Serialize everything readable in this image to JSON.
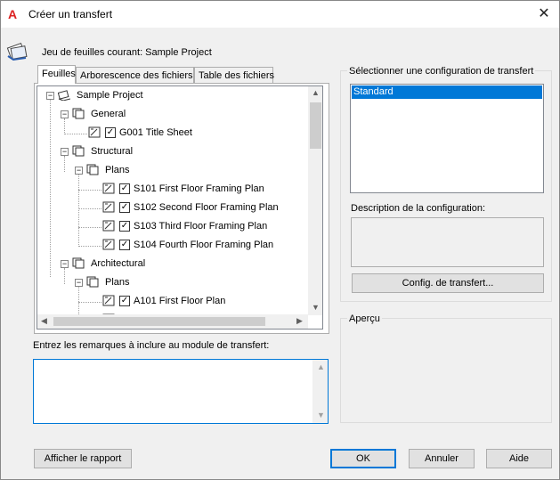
{
  "window": {
    "title": "Créer un transfert",
    "close_glyph": "✕",
    "app_icon": "A"
  },
  "header": {
    "current_sheetset": "Jeu de feuilles courant: Sample Project"
  },
  "tabs": [
    {
      "label": "Feuilles",
      "active": true
    },
    {
      "label": "Arborescence des fichiers",
      "active": false
    },
    {
      "label": "Table des fichiers",
      "active": false
    }
  ],
  "tree": {
    "root": "Sample Project",
    "general": "General",
    "g001": "G001 Title Sheet",
    "structural": "Structural",
    "plans1": "Plans",
    "s101": "S101 First Floor Framing Plan",
    "s102": "S102 Second Floor Framing Plan",
    "s103": "S103 Third Floor Framing Plan",
    "s104": "S104 Fourth Floor Framing Plan",
    "architectural": "Architectural",
    "plans2": "Plans",
    "a101": "A101 First Floor Plan"
  },
  "notes": {
    "label": "Entrez les remarques à inclure au module de transfert:",
    "value": ""
  },
  "config": {
    "legend": "Sélectionner une configuration de transfert",
    "items": [
      "Standard"
    ],
    "description_label": "Description de la configuration:",
    "description": "",
    "button": "Config. de transfert..."
  },
  "preview": {
    "legend": "Aperçu"
  },
  "buttons": {
    "report": "Afficher le rapport",
    "ok": "OK",
    "cancel": "Annuler",
    "help": "Aide"
  }
}
